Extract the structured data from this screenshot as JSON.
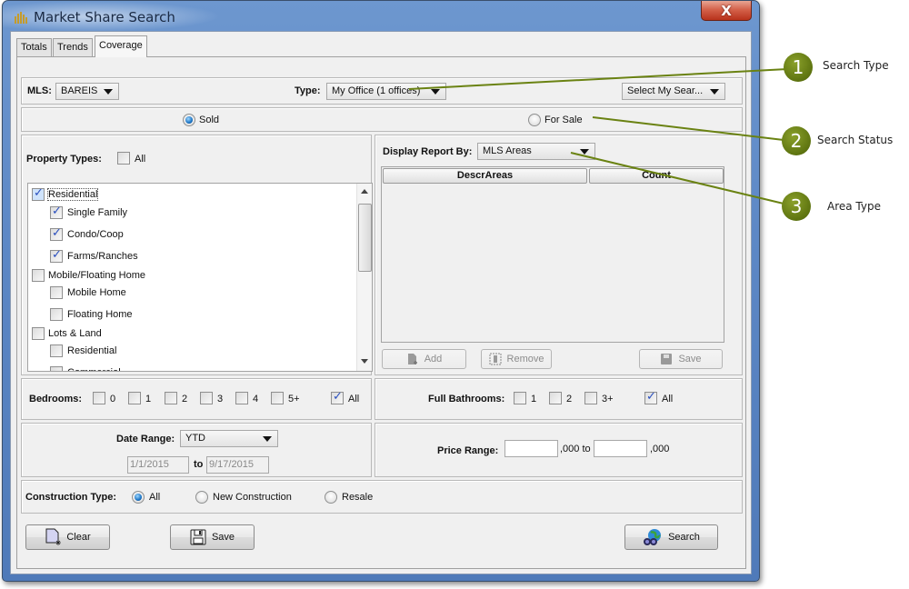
{
  "window": {
    "title": "Market Share Search",
    "close_label": "X"
  },
  "tabs": [
    {
      "label": "Totals",
      "active": false
    },
    {
      "label": "Trends",
      "active": false
    },
    {
      "label": "Coverage",
      "active": true
    }
  ],
  "top_bar": {
    "mls_label": "MLS:",
    "mls_value": "BAREIS",
    "type_label": "Type:",
    "type_value": "My Office (1 offices)",
    "saved_search_value": "Select My Sear..."
  },
  "status": {
    "options": [
      {
        "label": "Sold",
        "selected": true
      },
      {
        "label": "For Sale",
        "selected": false
      }
    ]
  },
  "property_types": {
    "label": "Property Types:",
    "all_label": "All",
    "all_checked": false,
    "items": [
      {
        "label": "Residential",
        "checked": true,
        "level": 0
      },
      {
        "label": "Single Family",
        "checked": true,
        "level": 1
      },
      {
        "label": "Condo/Coop",
        "checked": true,
        "level": 1
      },
      {
        "label": "Farms/Ranches",
        "checked": true,
        "level": 1
      },
      {
        "label": "Mobile/Floating Home",
        "checked": false,
        "level": 0
      },
      {
        "label": "Mobile Home",
        "checked": false,
        "level": 1
      },
      {
        "label": "Floating Home",
        "checked": false,
        "level": 1
      },
      {
        "label": "Lots & Land",
        "checked": false,
        "level": 0
      },
      {
        "label": "Residential",
        "checked": false,
        "level": 1
      },
      {
        "label": "Commercial",
        "checked": false,
        "level": 1
      }
    ]
  },
  "report": {
    "label": "Display Report By:",
    "value": "MLS Areas",
    "columns": [
      "DescrAreas",
      "Count"
    ],
    "add_label": "Add",
    "remove_label": "Remove",
    "save_label": "Save"
  },
  "bedrooms": {
    "label": "Bedrooms:",
    "options": [
      {
        "label": "0",
        "checked": false
      },
      {
        "label": "1",
        "checked": false
      },
      {
        "label": "2",
        "checked": false
      },
      {
        "label": "3",
        "checked": false
      },
      {
        "label": "4",
        "checked": false
      },
      {
        "label": "5+",
        "checked": false
      },
      {
        "label": "All",
        "checked": true
      }
    ]
  },
  "bathrooms": {
    "label": "Full Bathrooms:",
    "options": [
      {
        "label": "1",
        "checked": false
      },
      {
        "label": "2",
        "checked": false
      },
      {
        "label": "3+",
        "checked": false
      },
      {
        "label": "All",
        "checked": true
      }
    ]
  },
  "date_range": {
    "label": "Date Range:",
    "value": "YTD",
    "from": "1/1/2015",
    "to_label": "to",
    "to": "9/17/2015"
  },
  "price_range": {
    "label": "Price Range:",
    "min": "",
    "mid_label": ",000 to",
    "max": "",
    "suffix": ",000"
  },
  "construction": {
    "label": "Construction Type:",
    "options": [
      {
        "label": "All",
        "selected": true
      },
      {
        "label": "New Construction",
        "selected": false
      },
      {
        "label": "Resale",
        "selected": false
      }
    ]
  },
  "actions": {
    "clear_label": "Clear",
    "save_label": "Save",
    "search_label": "Search"
  },
  "callouts": [
    {
      "number": "1",
      "label": "Search Type"
    },
    {
      "number": "2",
      "label": "Search Status"
    },
    {
      "number": "3",
      "label": "Area Type"
    }
  ],
  "colors": {
    "callout": "#5e7410",
    "title_bar": "#5d88c6",
    "radio_selected": "#1a73c4",
    "check": "#2a4fbf"
  }
}
